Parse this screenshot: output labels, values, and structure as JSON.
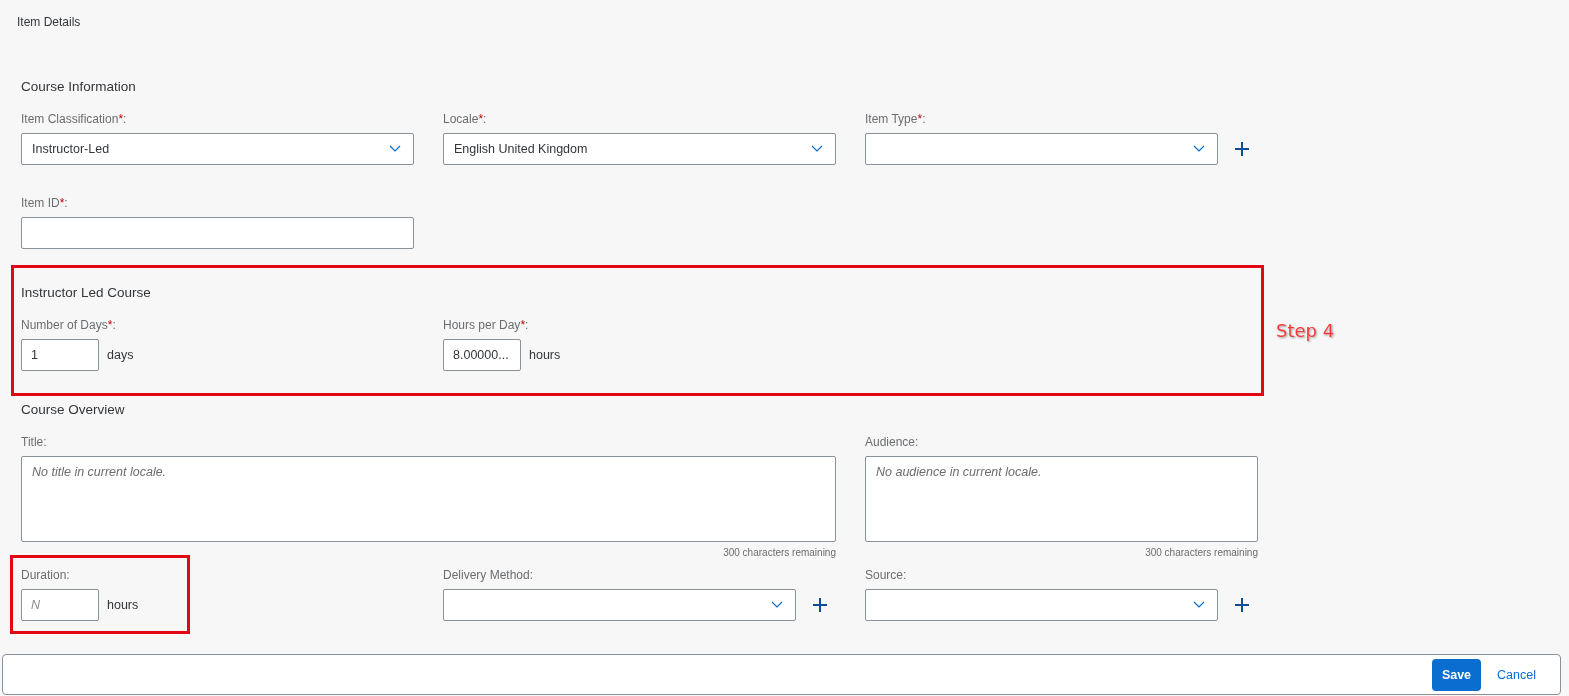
{
  "page_title": "Item Details",
  "sections": [
    {
      "heading": "Course Information",
      "highlighted": false,
      "rows": [
        [
          {
            "kind": "select",
            "label": "Item Classification",
            "required_mark": "*",
            "label_end": ":",
            "value": "Instructor-Led",
            "add_button": false
          },
          {
            "kind": "select",
            "label": "Locale",
            "required_mark": "*",
            "label_end": ":",
            "value": "English United Kingdom",
            "add_button": false
          },
          {
            "kind": "select",
            "label": "Item Type",
            "required_mark": "*",
            "label_end": ":",
            "add_button": true
          }
        ],
        [
          {
            "kind": "text",
            "label": "Item ID",
            "required_mark": "*",
            "label_end": ":"
          }
        ]
      ]
    },
    {
      "heading": "Instructor Led Course",
      "highlighted": true,
      "callout": "Step 4",
      "rows": [
        [
          {
            "kind": "unit",
            "label": "Number of Days",
            "required_mark": "*",
            "label_end": ":",
            "value": "1",
            "unit": "days",
            "highlighted": false
          },
          {
            "kind": "unit",
            "label": "Hours per Day",
            "required_mark": "*",
            "label_end": ":",
            "value": "8.00000...",
            "unit": "hours",
            "highlighted": false
          }
        ]
      ]
    },
    {
      "heading": "Course Overview",
      "highlighted": false,
      "rows": [
        [
          {
            "kind": "textarea",
            "label": "Title:",
            "placeholder": "No title in current locale.",
            "counter": "300 characters remaining"
          },
          "",
          {
            "kind": "textarea",
            "label": "Audience:",
            "placeholder": "No audience in current locale.",
            "counter": "300 characters remaining"
          }
        ],
        [
          {
            "kind": "unit",
            "label": "Duration:",
            "placeholder": "N",
            "unit": "hours",
            "highlighted": true
          },
          {
            "kind": "select",
            "label": "Delivery Method:",
            "add_button": true
          },
          {
            "kind": "select",
            "label": "Source:",
            "add_button": true
          }
        ]
      ]
    }
  ],
  "footer_buttons": [
    {
      "label": "Save",
      "kind": "primary"
    },
    {
      "label": "Cancel",
      "kind": "link"
    }
  ]
}
